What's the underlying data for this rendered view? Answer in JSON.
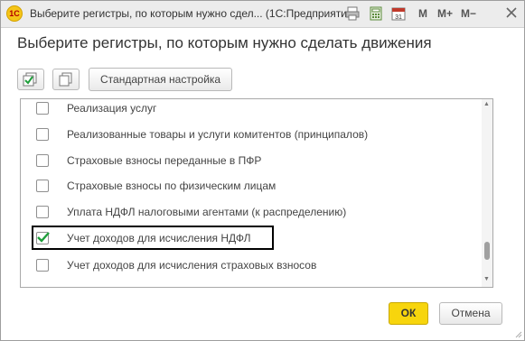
{
  "window": {
    "app_logo_text": "1С",
    "title": "Выберите регистры, по которым нужно сдел... (1С:Предприятие)",
    "toolbar": {
      "m_label": "M",
      "m_plus_label": "M+",
      "m_minus_label": "M−",
      "calendar_day": "31"
    }
  },
  "dialog": {
    "heading": "Выберите регистры, по которым нужно сделать движения",
    "standard_settings_label": "Стандартная настройка",
    "registers": [
      {
        "label": "Реализация услуг",
        "checked": false
      },
      {
        "label": "Реализованные товары и услуги комитентов (принципалов)",
        "checked": false
      },
      {
        "label": "Страховые взносы переданные в ПФР",
        "checked": false
      },
      {
        "label": "Страховые взносы по физическим лицам",
        "checked": false
      },
      {
        "label": "Уплата НДФЛ налоговыми агентами (к распределению)",
        "checked": false
      },
      {
        "label": "Учет доходов для исчисления НДФЛ",
        "checked": true
      },
      {
        "label": "Учет доходов для исчисления страховых взносов",
        "checked": false
      }
    ],
    "ok_label": "ОК",
    "cancel_label": "Отмена"
  },
  "colors": {
    "ok_button": "#f7d50d",
    "checkmark": "#1e9e3a",
    "highlight_frame": "#000000"
  }
}
